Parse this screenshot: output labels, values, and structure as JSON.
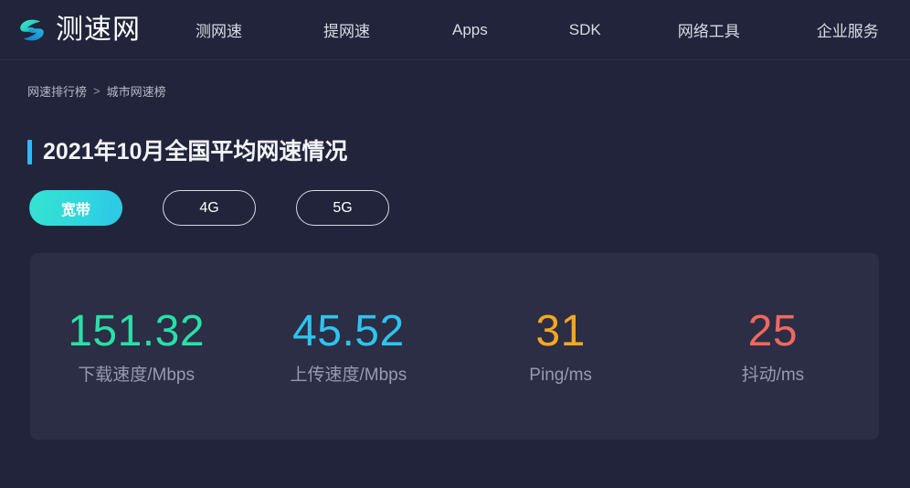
{
  "header": {
    "logo_icon": "speedtest-swoosh-icon",
    "logo_text": "测速网",
    "nav": [
      {
        "label": "测网速"
      },
      {
        "label": "提网速"
      },
      {
        "label": "Apps"
      },
      {
        "label": "SDK"
      },
      {
        "label": "网络工具"
      },
      {
        "label": "企业服务"
      }
    ]
  },
  "breadcrumb": {
    "items": [
      {
        "label": "网速排行榜"
      },
      {
        "label": "城市网速榜"
      }
    ],
    "separator": ">"
  },
  "page": {
    "title": "2021年10月全国平均网速情况"
  },
  "filters": {
    "options": [
      {
        "label": "宽带",
        "active": true
      },
      {
        "label": "4G",
        "active": false
      },
      {
        "label": "5G",
        "active": false
      }
    ]
  },
  "stats": [
    {
      "value": "151.32",
      "label": "下载速度/Mbps",
      "color": "#28e0a8"
    },
    {
      "value": "45.52",
      "label": "上传速度/Mbps",
      "color": "#2ec4ef"
    },
    {
      "value": "31",
      "label": "Ping/ms",
      "color": "#f5a623"
    },
    {
      "value": "25",
      "label": "抖动/ms",
      "color": "#f0685e"
    }
  ],
  "colors": {
    "page_background": "#21243a",
    "card_background": "#2b2e45",
    "accent_bar": "#35b6f5",
    "pill_active_from": "#35e3d0",
    "pill_active_to": "#2ec7e6",
    "logo_teal": "#25d5c0",
    "logo_blue": "#1f9fd8",
    "label_gray": "#959bb1"
  }
}
